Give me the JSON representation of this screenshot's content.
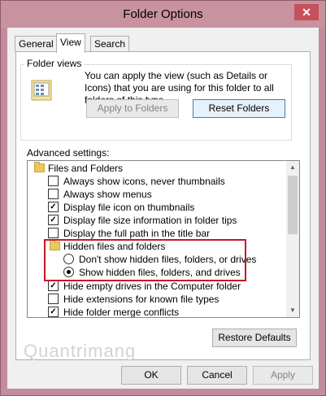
{
  "window": {
    "title": "Folder Options",
    "close_icon": "✕"
  },
  "tabs": [
    {
      "label": "General"
    },
    {
      "label": "View"
    },
    {
      "label": "Search"
    }
  ],
  "folder_views": {
    "group_label": "Folder views",
    "description": "You can apply the view (such as Details or Icons) that you are using for this folder to all folders of this type.",
    "apply_label": "Apply to Folders",
    "reset_label": "Reset Folders"
  },
  "advanced": {
    "label": "Advanced settings:",
    "items": [
      {
        "type": "folder",
        "text": "Files and Folders"
      },
      {
        "type": "checkbox",
        "checked": false,
        "text": "Always show icons, never thumbnails"
      },
      {
        "type": "checkbox",
        "checked": false,
        "text": "Always show menus"
      },
      {
        "type": "checkbox",
        "checked": true,
        "text": "Display file icon on thumbnails"
      },
      {
        "type": "checkbox",
        "checked": true,
        "text": "Display file size information in folder tips"
      },
      {
        "type": "checkbox",
        "checked": false,
        "text": "Display the full path in the title bar"
      },
      {
        "type": "folder",
        "text": "Hidden files and folders"
      },
      {
        "type": "radio",
        "checked": false,
        "text": "Don't show hidden files, folders, or drives"
      },
      {
        "type": "radio",
        "checked": true,
        "text": "Show hidden files, folders, and drives"
      },
      {
        "type": "checkbox",
        "checked": true,
        "text": "Hide empty drives in the Computer folder"
      },
      {
        "type": "checkbox",
        "checked": false,
        "text": "Hide extensions for known file types"
      },
      {
        "type": "checkbox",
        "checked": true,
        "text": "Hide folder merge conflicts"
      }
    ],
    "restore_label": "Restore Defaults"
  },
  "footer": {
    "ok_label": "OK",
    "cancel_label": "Cancel",
    "apply_label": "Apply"
  },
  "watermark": "Quantrimang",
  "colors": {
    "highlight": "#c5162a",
    "title_bar": "#c9929f"
  }
}
